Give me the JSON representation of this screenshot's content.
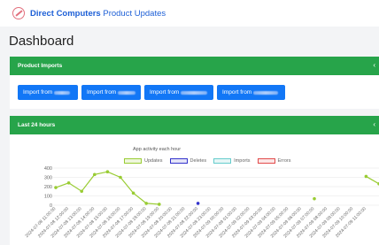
{
  "header": {
    "brand_bold": "Direct Computers",
    "brand_rest": " Product Updates"
  },
  "page": {
    "title": "Dashboard"
  },
  "product_imports": {
    "title": "Product Imports",
    "buttons": [
      {
        "label": "Import from"
      },
      {
        "label": "Import from"
      },
      {
        "label": "Import from"
      },
      {
        "label": "Import from"
      }
    ]
  },
  "last_24": {
    "title": "Last 24 hours"
  },
  "colors": {
    "accent_green": "#27a44a",
    "button_blue": "#1277f6",
    "updates": "#99cc33",
    "deletes": "#3333cc",
    "imports": "#66cccc",
    "errors": "#e24b4b"
  },
  "chart_data": {
    "type": "line",
    "title": "App activity each hour",
    "ylim": [
      0,
      400
    ],
    "yticks": [
      0,
      100,
      200,
      300,
      400
    ],
    "legend_position": "top",
    "x": [
      "2024-07-08 11:00:00",
      "2024-07-08 12:00:00",
      "2024-07-08 13:00:00",
      "2024-07-08 14:00:00",
      "2024-07-08 15:00:00",
      "2024-07-08 16:00:00",
      "2024-07-08 17:00:00",
      "2024-07-08 18:00:00",
      "2024-07-08 19:00:00",
      "2024-07-08 20:00:00",
      "2024-07-08 21:00:00",
      "2024-07-08 22:00:00",
      "2024-07-08 23:00:00",
      "2024-07-09 00:00:00",
      "2024-07-09 01:00:00",
      "2024-07-09 02:00:00",
      "2024-07-09 03:00:00",
      "2024-07-09 04:00:00",
      "2024-07-09 05:00:00",
      "2024-07-09 06:00:00",
      "2024-07-09 07:00:00",
      "2024-07-09 08:00:00",
      "2024-07-09 09:00:00",
      "2024-07-09 10:00:00",
      "2024-07-09 11:00:00"
    ],
    "series": [
      {
        "name": "Updates",
        "color": "#99cc33",
        "values": [
          190,
          240,
          150,
          330,
          360,
          300,
          130,
          20,
          10,
          null,
          null,
          null,
          null,
          null,
          null,
          null,
          null,
          null,
          null,
          null,
          70,
          null,
          null,
          null,
          310,
          230
        ]
      },
      {
        "name": "Deletes",
        "color": "#3333cc",
        "values": [
          null,
          null,
          null,
          null,
          null,
          null,
          null,
          null,
          null,
          null,
          null,
          20,
          null,
          null,
          null,
          null,
          null,
          null,
          null,
          null,
          null,
          null,
          null,
          null,
          null,
          null
        ]
      },
      {
        "name": "Imports",
        "color": "#66cccc",
        "values": []
      },
      {
        "name": "Errors",
        "color": "#e24b4b",
        "values": []
      }
    ]
  }
}
